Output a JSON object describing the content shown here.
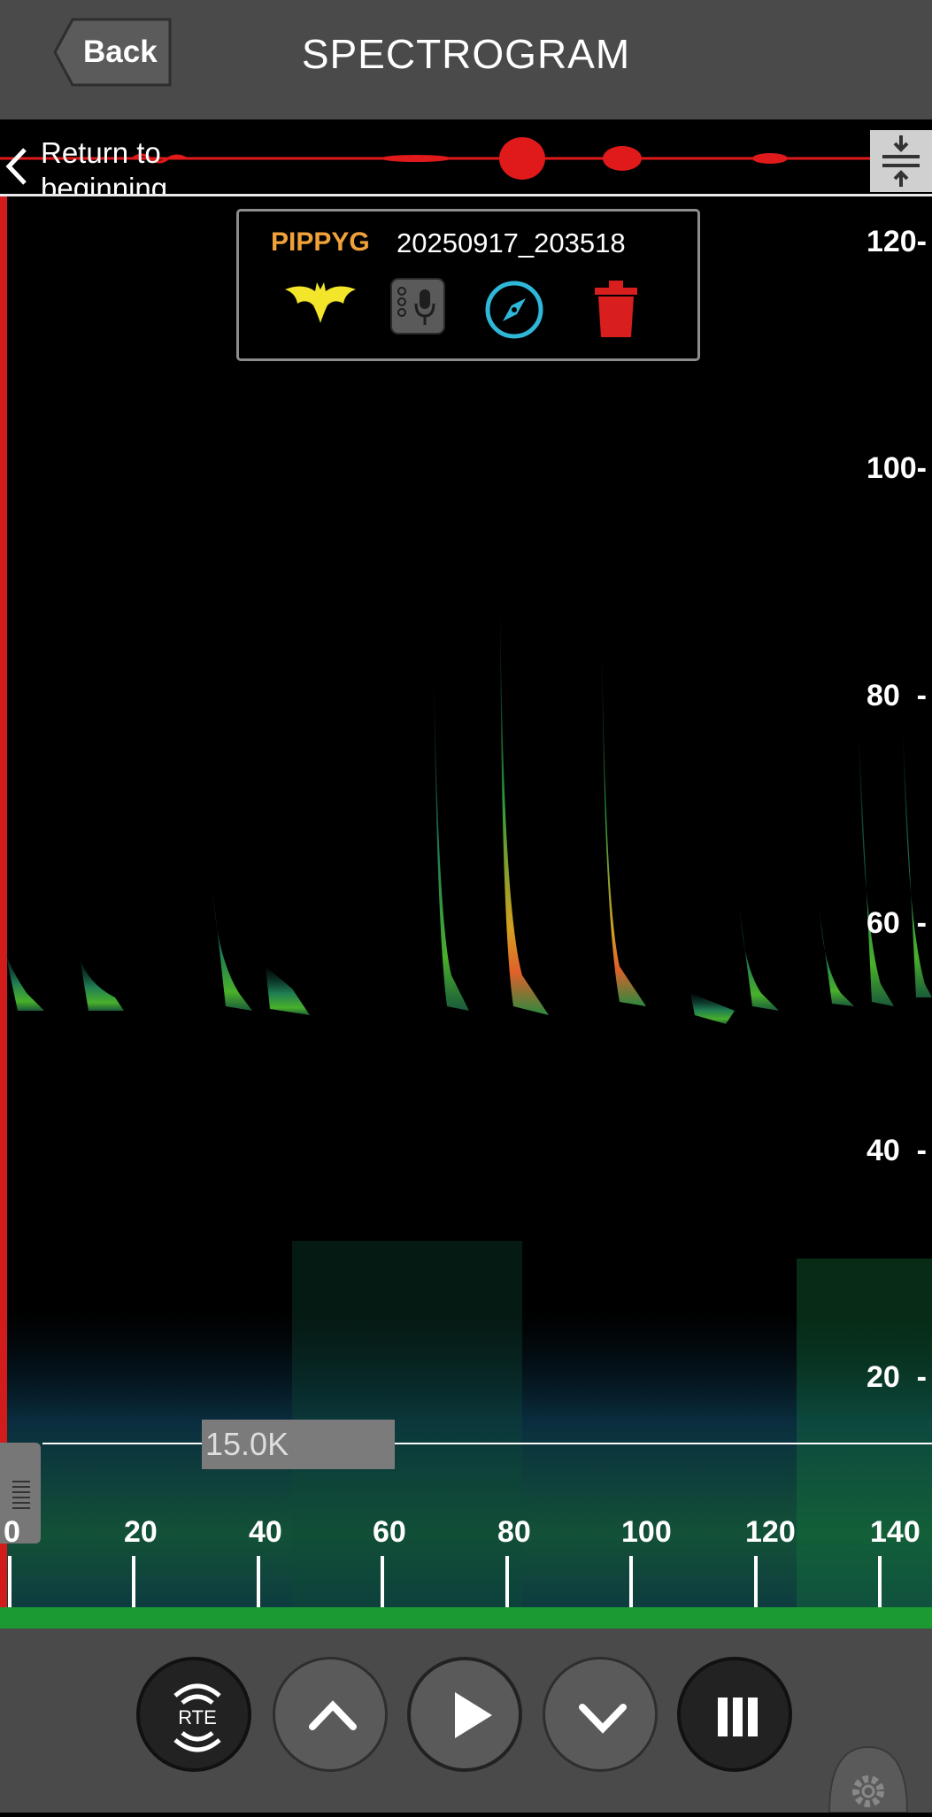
{
  "header": {
    "back_label": "Back",
    "title": "SPECTROGRAM"
  },
  "waveform": {
    "return_label": "Return to beginning",
    "expand_icon": "expand-vertical-icon"
  },
  "recording": {
    "species": "PIPPYG",
    "filename": "20250917_203518",
    "icons": [
      "bat-icon",
      "microphone-device-icon",
      "compass-icon",
      "trash-icon"
    ]
  },
  "y_axis": {
    "labels": [
      "120-",
      "100-",
      "80  -",
      "60  -",
      "40  -",
      "20  -"
    ]
  },
  "x_axis": {
    "labels": [
      "0",
      "20",
      "40",
      "60",
      "80",
      "100",
      "120",
      "140"
    ]
  },
  "threshold": {
    "label": "15.0K"
  },
  "controls": {
    "rte_label": "RTE",
    "buttons": [
      "rte-button",
      "up-button",
      "play-button",
      "down-button",
      "pause-button"
    ],
    "settings_icon": "gear-icon"
  },
  "colors": {
    "species": "#f0a239",
    "playhead": "#d21c1c",
    "waveform": "#e01a1a",
    "green_bar": "#1b9a34"
  }
}
